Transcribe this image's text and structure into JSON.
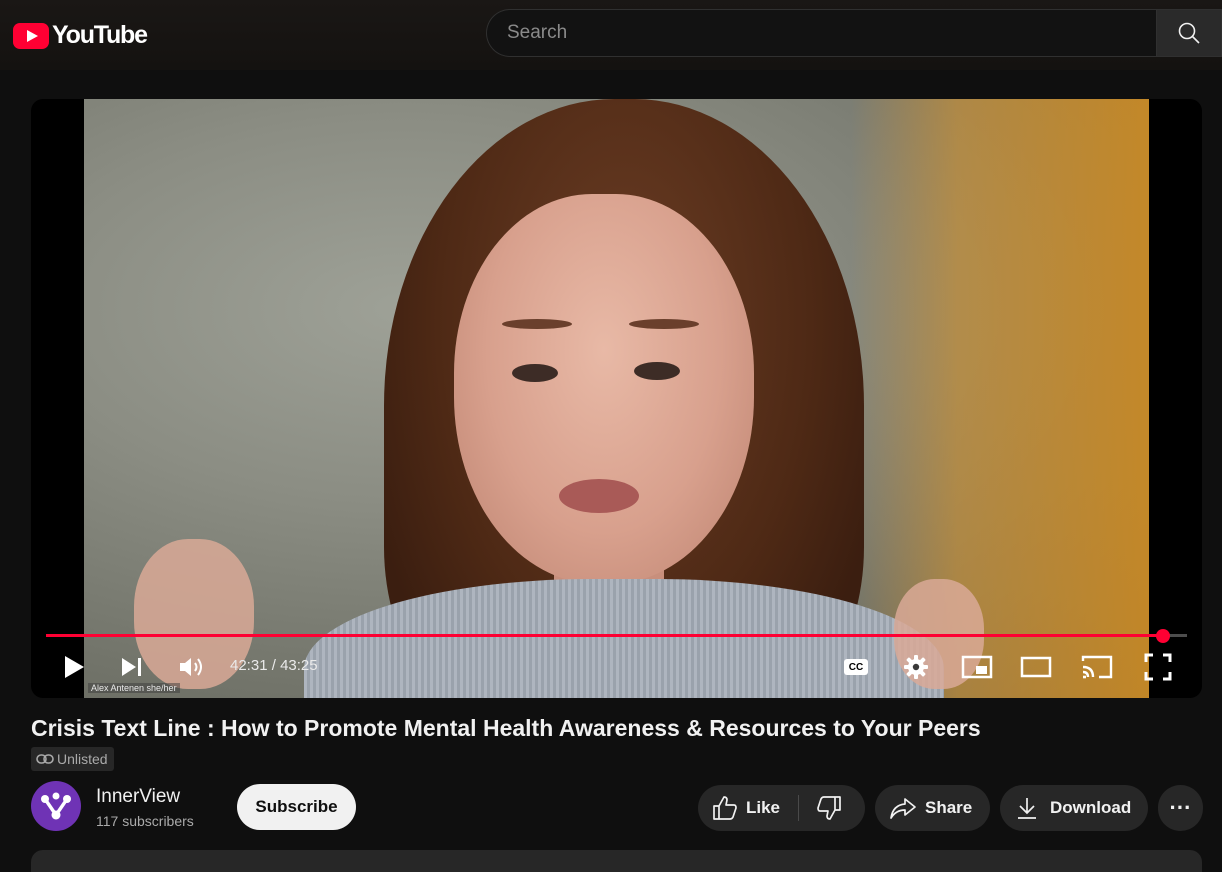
{
  "header": {
    "logo_text": "YouTube",
    "search_placeholder": "Search"
  },
  "player": {
    "current_time": "42:31",
    "total_time": "43:25",
    "time_separator": " / ",
    "progress_fraction": 0.979,
    "speaker_label": "Alex Antenen she/her",
    "cc_label": "CC",
    "progress_color": "#ff0033"
  },
  "video": {
    "title": "Crisis Text Line : How to Promote Mental Health Awareness & Resources to Your Peers",
    "visibility": "Unlisted"
  },
  "channel": {
    "name": "InnerView",
    "subscribers": "117 subscribers",
    "subscribe_label": "Subscribe",
    "avatar_color": "#6f33b5"
  },
  "actions": {
    "like_label": "Like",
    "share_label": "Share",
    "download_label": "Download",
    "more_label": "···"
  }
}
